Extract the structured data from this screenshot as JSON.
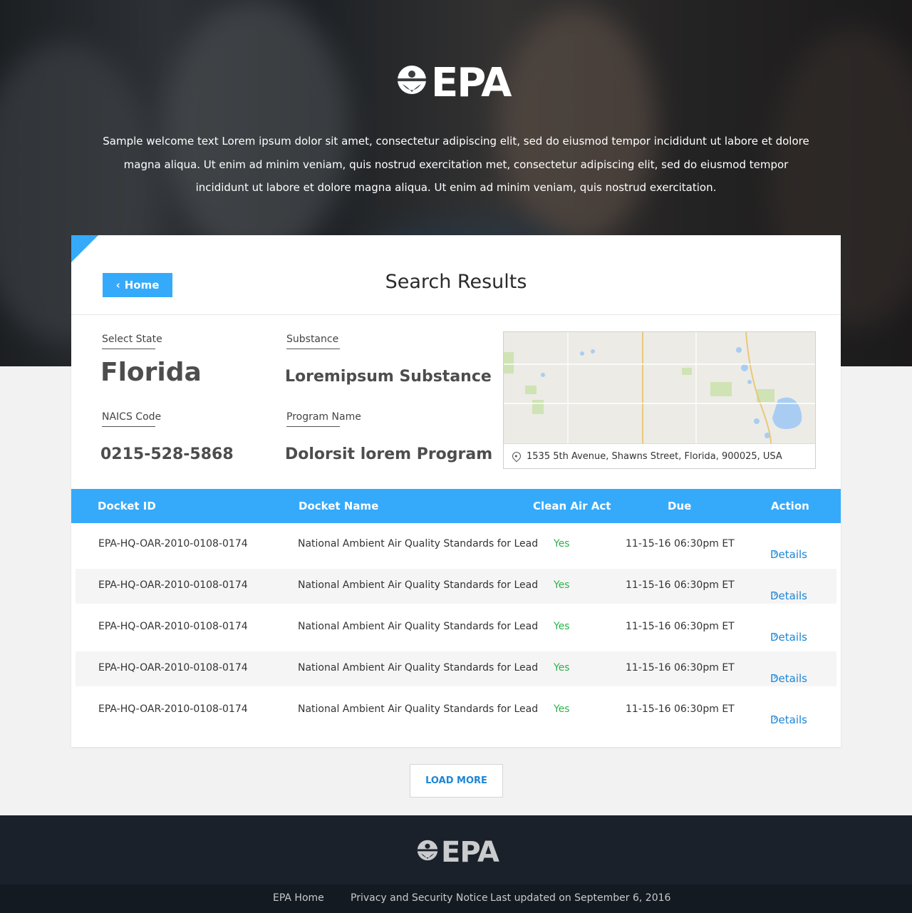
{
  "header": {
    "logo_text": "EPA",
    "welcome_text": "Sample welcome text Lorem ipsum dolor sit amet, consectetur adipiscing elit, sed do eiusmod tempor incididunt ut labore et dolore magna aliqua. Ut enim ad minim veniam, quis nostrud exercitation met, consectetur adipiscing elit, sed do eiusmod tempor incididunt ut labore et dolore magna aliqua. Ut enim ad minim veniam, quis nostrud exercitation."
  },
  "card": {
    "home_button": "Home",
    "title": "Search Results",
    "accent_color": "#35aafb"
  },
  "filters": {
    "state_label": "Select State",
    "state_value": "Florida",
    "substance_label": "Substance",
    "substance_value": "Loremipsum Substance",
    "naics_label": "NAICS Code",
    "naics_value": "0215-528-5868",
    "program_label": "Program Name",
    "program_value": "Dolorsit lorem Program"
  },
  "map": {
    "address": "1535 5th Avenue, Shawns Street, Florida, 900025, USA",
    "icon": "location-pin-icon"
  },
  "table": {
    "headers": {
      "docket_id": "Docket ID",
      "docket_name": "Docket Name",
      "clean_air_act": "Clean Air Act",
      "due": "Due",
      "action": "Action"
    },
    "rows": [
      {
        "docket_id": "EPA-HQ-OAR-2010-0108-0174",
        "docket_name": "National Ambient Air Quality Standards for Lead",
        "clean_air_act": "Yes",
        "due": "11-15-16 06:30pm ET",
        "action": "Details"
      },
      {
        "docket_id": "EPA-HQ-OAR-2010-0108-0174",
        "docket_name": "National Ambient Air Quality Standards for Lead",
        "clean_air_act": "Yes",
        "due": "11-15-16 06:30pm ET",
        "action": "Details"
      },
      {
        "docket_id": "EPA-HQ-OAR-2010-0108-0174",
        "docket_name": "National Ambient Air Quality Standards for Lead",
        "clean_air_act": "Yes",
        "due": "11-15-16 06:30pm ET",
        "action": "Details"
      },
      {
        "docket_id": "EPA-HQ-OAR-2010-0108-0174",
        "docket_name": "National Ambient Air Quality Standards for Lead",
        "clean_air_act": "Yes",
        "due": "11-15-16 06:30pm ET",
        "action": "Details"
      },
      {
        "docket_id": "EPA-HQ-OAR-2010-0108-0174",
        "docket_name": "National Ambient Air Quality Standards for Lead",
        "clean_air_act": "Yes",
        "due": "11-15-16 06:30pm ET",
        "action": "Details"
      }
    ],
    "yes_color": "#2bb24c",
    "link_color": "#1c86d6"
  },
  "load_more": "LOAD MORE",
  "footer": {
    "logo_text": "EPA",
    "links": [
      "EPA Home",
      "Privacy and Security Notice"
    ],
    "last_updated": "Last updated on September 6, 2016"
  }
}
